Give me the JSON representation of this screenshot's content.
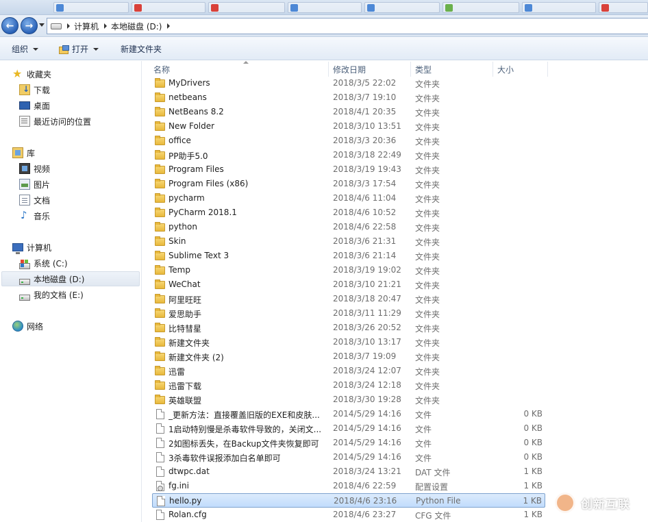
{
  "address": {
    "crumbs": [
      "计算机",
      "本地磁盘 (D:)"
    ]
  },
  "toolbar": {
    "organize_label": "组织",
    "open_label": "打开",
    "new_folder_label": "新建文件夹"
  },
  "sidebar": {
    "favorites": {
      "label": "收藏夹",
      "items": [
        "下载",
        "桌面",
        "最近访问的位置"
      ]
    },
    "libraries": {
      "label": "库",
      "items": [
        "视频",
        "图片",
        "文档",
        "音乐"
      ]
    },
    "computer": {
      "label": "计算机",
      "items": [
        "系统 (C:)",
        "本地磁盘 (D:)",
        "我的文档 (E:)"
      ]
    },
    "network": {
      "label": "网络"
    }
  },
  "columns": {
    "name": "名称",
    "date": "修改日期",
    "type": "类型",
    "size": "大小"
  },
  "files": [
    {
      "name": "MyDrivers",
      "date": "2018/3/5 22:02",
      "type": "文件夹",
      "size": "",
      "kind": "folder"
    },
    {
      "name": "netbeans",
      "date": "2018/3/7 19:10",
      "type": "文件夹",
      "size": "",
      "kind": "folder"
    },
    {
      "name": "NetBeans 8.2",
      "date": "2018/4/1 20:35",
      "type": "文件夹",
      "size": "",
      "kind": "folder"
    },
    {
      "name": "New Folder",
      "date": "2018/3/10 13:51",
      "type": "文件夹",
      "size": "",
      "kind": "folder"
    },
    {
      "name": "office",
      "date": "2018/3/3 20:36",
      "type": "文件夹",
      "size": "",
      "kind": "folder"
    },
    {
      "name": "PP助手5.0",
      "date": "2018/3/18 22:49",
      "type": "文件夹",
      "size": "",
      "kind": "folder"
    },
    {
      "name": "Program Files",
      "date": "2018/3/19 19:43",
      "type": "文件夹",
      "size": "",
      "kind": "folder"
    },
    {
      "name": "Program Files (x86)",
      "date": "2018/3/3 17:54",
      "type": "文件夹",
      "size": "",
      "kind": "folder"
    },
    {
      "name": "pycharm",
      "date": "2018/4/6 11:04",
      "type": "文件夹",
      "size": "",
      "kind": "folder"
    },
    {
      "name": "PyCharm 2018.1",
      "date": "2018/4/6 10:52",
      "type": "文件夹",
      "size": "",
      "kind": "folder"
    },
    {
      "name": "python",
      "date": "2018/4/6 22:58",
      "type": "文件夹",
      "size": "",
      "kind": "folder"
    },
    {
      "name": "Skin",
      "date": "2018/3/6 21:31",
      "type": "文件夹",
      "size": "",
      "kind": "folder"
    },
    {
      "name": "Sublime Text 3",
      "date": "2018/3/6 21:14",
      "type": "文件夹",
      "size": "",
      "kind": "folder"
    },
    {
      "name": "Temp",
      "date": "2018/3/19 19:02",
      "type": "文件夹",
      "size": "",
      "kind": "folder"
    },
    {
      "name": "WeChat",
      "date": "2018/3/10 21:21",
      "type": "文件夹",
      "size": "",
      "kind": "folder"
    },
    {
      "name": "阿里旺旺",
      "date": "2018/3/18 20:47",
      "type": "文件夹",
      "size": "",
      "kind": "folder"
    },
    {
      "name": "爱思助手",
      "date": "2018/3/11 11:29",
      "type": "文件夹",
      "size": "",
      "kind": "folder"
    },
    {
      "name": "比特彗星",
      "date": "2018/3/26 20:52",
      "type": "文件夹",
      "size": "",
      "kind": "folder"
    },
    {
      "name": "新建文件夹",
      "date": "2018/3/10 13:17",
      "type": "文件夹",
      "size": "",
      "kind": "folder"
    },
    {
      "name": "新建文件夹 (2)",
      "date": "2018/3/7 19:09",
      "type": "文件夹",
      "size": "",
      "kind": "folder"
    },
    {
      "name": "迅雷",
      "date": "2018/3/24 12:07",
      "type": "文件夹",
      "size": "",
      "kind": "folder"
    },
    {
      "name": "迅雷下载",
      "date": "2018/3/24 12:18",
      "type": "文件夹",
      "size": "",
      "kind": "folder"
    },
    {
      "name": "英雄联盟",
      "date": "2018/3/30 19:28",
      "type": "文件夹",
      "size": "",
      "kind": "folder"
    },
    {
      "name": "_更新方法：直接覆盖旧版的EXE和皮肤...",
      "date": "2014/5/29 14:16",
      "type": "文件",
      "size": "0 KB",
      "kind": "file"
    },
    {
      "name": "1启动特别慢是杀毒软件导致的，关闭文...",
      "date": "2014/5/29 14:16",
      "type": "文件",
      "size": "0 KB",
      "kind": "file"
    },
    {
      "name": "2如图标丢失，在Backup文件夹恢复即可",
      "date": "2014/5/29 14:16",
      "type": "文件",
      "size": "0 KB",
      "kind": "file"
    },
    {
      "name": "3杀毒软件误报添加白名单即可",
      "date": "2014/5/29 14:16",
      "type": "文件",
      "size": "0 KB",
      "kind": "file"
    },
    {
      "name": "dtwpc.dat",
      "date": "2018/3/24 13:21",
      "type": "DAT 文件",
      "size": "1 KB",
      "kind": "file"
    },
    {
      "name": "fg.ini",
      "date": "2018/4/6 22:59",
      "type": "配置设置",
      "size": "1 KB",
      "kind": "cfg"
    },
    {
      "name": "hello.py",
      "date": "2018/4/6 23:16",
      "type": "Python File",
      "size": "1 KB",
      "kind": "file",
      "selected": true
    },
    {
      "name": "Rolan.cfg",
      "date": "2018/4/6 23:27",
      "type": "CFG 文件",
      "size": "1 KB",
      "kind": "file"
    }
  ],
  "watermark": {
    "text": "创新互联"
  }
}
